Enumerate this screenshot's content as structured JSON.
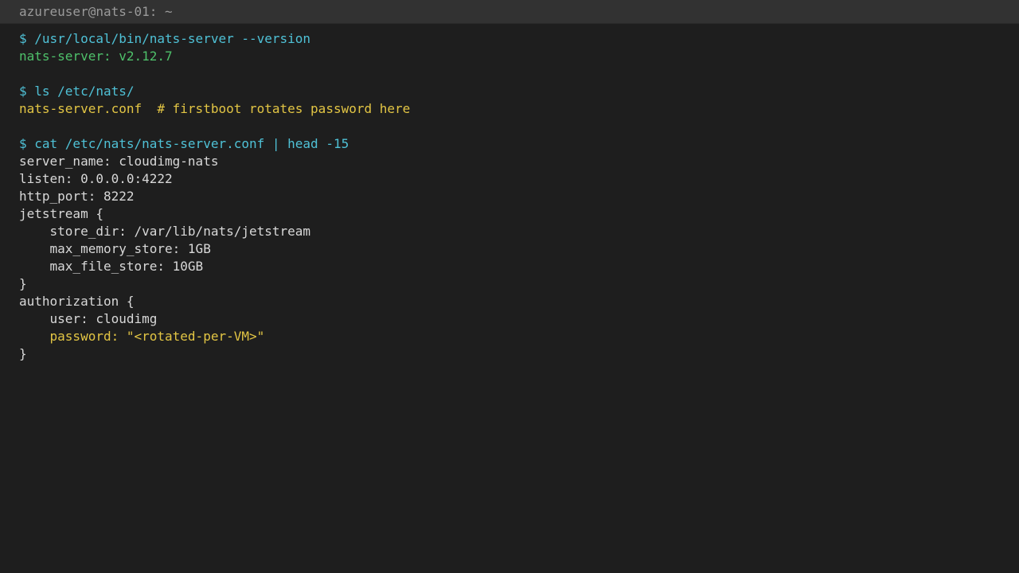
{
  "window": {
    "title": "azureuser@nats-01: ~"
  },
  "terminal": {
    "lines": [
      {
        "text": "$ /usr/local/bin/nats-server --version",
        "kind": "cmd"
      },
      {
        "text": "nats-server: v2.12.7",
        "kind": "ok"
      },
      {
        "text": "",
        "kind": "out"
      },
      {
        "text": "$ ls /etc/nats/",
        "kind": "cmd"
      },
      {
        "text": "nats-server.conf  # firstboot rotates password here",
        "kind": "warn"
      },
      {
        "text": "",
        "kind": "out"
      },
      {
        "text": "$ cat /etc/nats/nats-server.conf | head -15",
        "kind": "cmd"
      },
      {
        "text": "server_name: cloudimg-nats",
        "kind": "out"
      },
      {
        "text": "listen: 0.0.0.0:4222",
        "kind": "out"
      },
      {
        "text": "http_port: 8222",
        "kind": "out"
      },
      {
        "text": "jetstream {",
        "kind": "out"
      },
      {
        "text": "    store_dir: /var/lib/nats/jetstream",
        "kind": "out"
      },
      {
        "text": "    max_memory_store: 1GB",
        "kind": "out"
      },
      {
        "text": "    max_file_store: 10GB",
        "kind": "out"
      },
      {
        "text": "}",
        "kind": "out"
      },
      {
        "text": "authorization {",
        "kind": "out"
      },
      {
        "text": "    user: cloudimg",
        "kind": "out"
      },
      {
        "text": "    password: \"<rotated-per-VM>\"",
        "kind": "warn"
      },
      {
        "text": "}",
        "kind": "out"
      }
    ]
  },
  "colors": {
    "background": "#1e1e1e",
    "titlebar": "#323232",
    "command": "#4fc1d6",
    "success": "#4ec06a",
    "highlight": "#e2c544",
    "output": "#d8d8d8"
  }
}
